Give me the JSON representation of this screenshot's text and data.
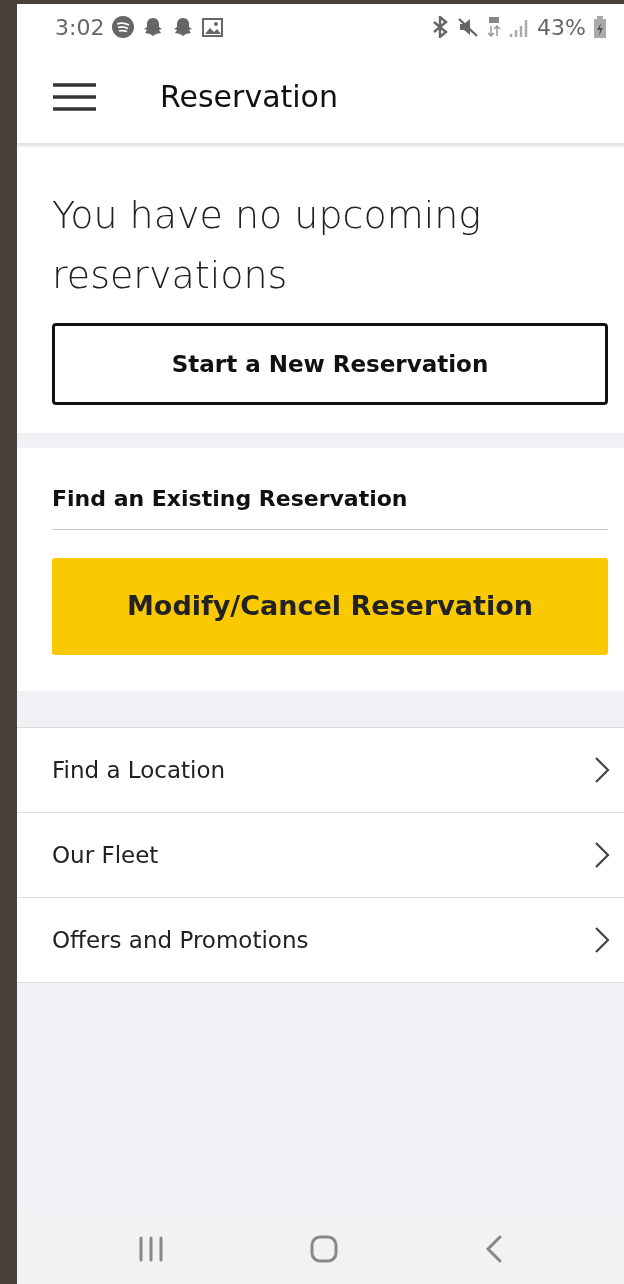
{
  "status_bar": {
    "time": "3:02",
    "battery": "43%"
  },
  "app_bar": {
    "title": "Reservation"
  },
  "upcoming": {
    "message": "You have no upcoming reservations",
    "button": "Start a New Reservation"
  },
  "find_existing": {
    "heading": "Find an Existing Reservation",
    "button": "Modify/Cancel Reservation"
  },
  "menu_items": [
    {
      "label": "Find a Location"
    },
    {
      "label": "Our Fleet"
    },
    {
      "label": "Offers and Promotions"
    }
  ]
}
